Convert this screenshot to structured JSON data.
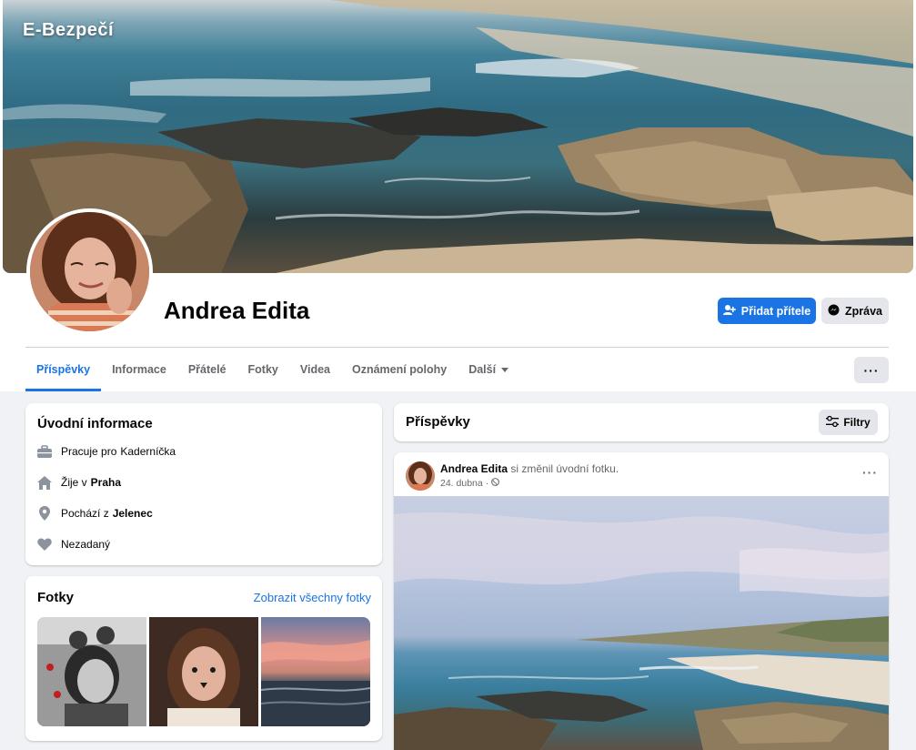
{
  "brand": "E-Bezpečí",
  "profile": {
    "name": "Andrea Edita",
    "add_friend_label": "Přidat přítele",
    "message_label": "Zpráva"
  },
  "tabs": [
    {
      "label": "Příspěvky",
      "active": true
    },
    {
      "label": "Informace"
    },
    {
      "label": "Přátelé"
    },
    {
      "label": "Fotky"
    },
    {
      "label": "Videa"
    },
    {
      "label": "Oznámení polohy"
    },
    {
      "label": "Další"
    }
  ],
  "more_label": "···",
  "intro": {
    "title": "Úvodní informace",
    "work_prefix": "Pracuje pro",
    "work_value": "Kaderníčka",
    "lives_prefix": "Žije v",
    "lives_value": "Praha",
    "from_prefix": "Pochází z",
    "from_value": "Jelenec",
    "relationship": "Nezadaný"
  },
  "photos": {
    "title": "Fotky",
    "see_all": "Zobrazit všechny fotky"
  },
  "posts": {
    "title": "Příspěvky",
    "filter_label": "Filtry"
  },
  "post": {
    "author": "Andrea Edita",
    "action": "si změnil úvodní fotku.",
    "date": "24. dubna",
    "separator": "·",
    "menu": "···"
  },
  "colors": {
    "accent": "#1b74e4",
    "background": "#f0f2f5",
    "secondary_button": "#e4e6eb",
    "muted_text": "#65676b"
  },
  "icons": {
    "work": "briefcase-icon",
    "lives": "home-icon",
    "from": "location-pin-icon",
    "relationship": "heart-icon",
    "add_friend": "add-person-icon",
    "message": "messenger-icon",
    "filter": "sliders-icon",
    "privacy": "globe-icon"
  }
}
